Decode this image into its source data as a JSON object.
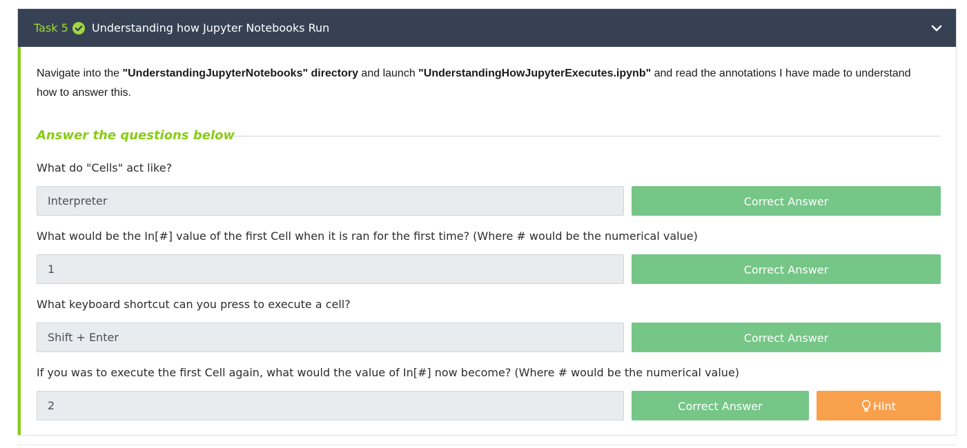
{
  "task": {
    "number_label": "Task 5",
    "title": "Understanding how Jupyter Notebooks Run",
    "completed_icon": "check-circle-icon",
    "expand_icon": "chevron-down-icon",
    "colors": {
      "header_bg": "#364254",
      "accent": "#88cc14",
      "correct": "#75c687",
      "hint": "#f9a04d"
    }
  },
  "instructions": {
    "part1": "Navigate into the ",
    "bold1": "\"UnderstandingJupyterNotebooks\" directory",
    "part2": " and launch ",
    "bold2": "\"UnderstandingHowJupyterExecutes.ipynb\"",
    "part3": " and read the annotations I have made to understand how to answer this."
  },
  "answers_heading": "Answer the questions below",
  "questions": [
    {
      "text": "What do \"Cells\" act like?",
      "answer": "Interpreter",
      "button": "Correct Answer"
    },
    {
      "text": "What would be the In[#] value of the first Cell when it is ran for the first time? (Where # would be the numerical value)",
      "answer": "1",
      "button": "Correct Answer"
    },
    {
      "text": "What keyboard shortcut can you press to execute a cell?",
      "answer": "Shift + Enter",
      "button": "Correct Answer"
    },
    {
      "text": "If you was to execute the first Cell again, what would the value of In[#] now become? (Where # would be the numerical value)",
      "answer": "2",
      "button": "Correct Answer"
    }
  ],
  "hint": {
    "label": "Hint",
    "icon": "lightbulb-icon"
  }
}
